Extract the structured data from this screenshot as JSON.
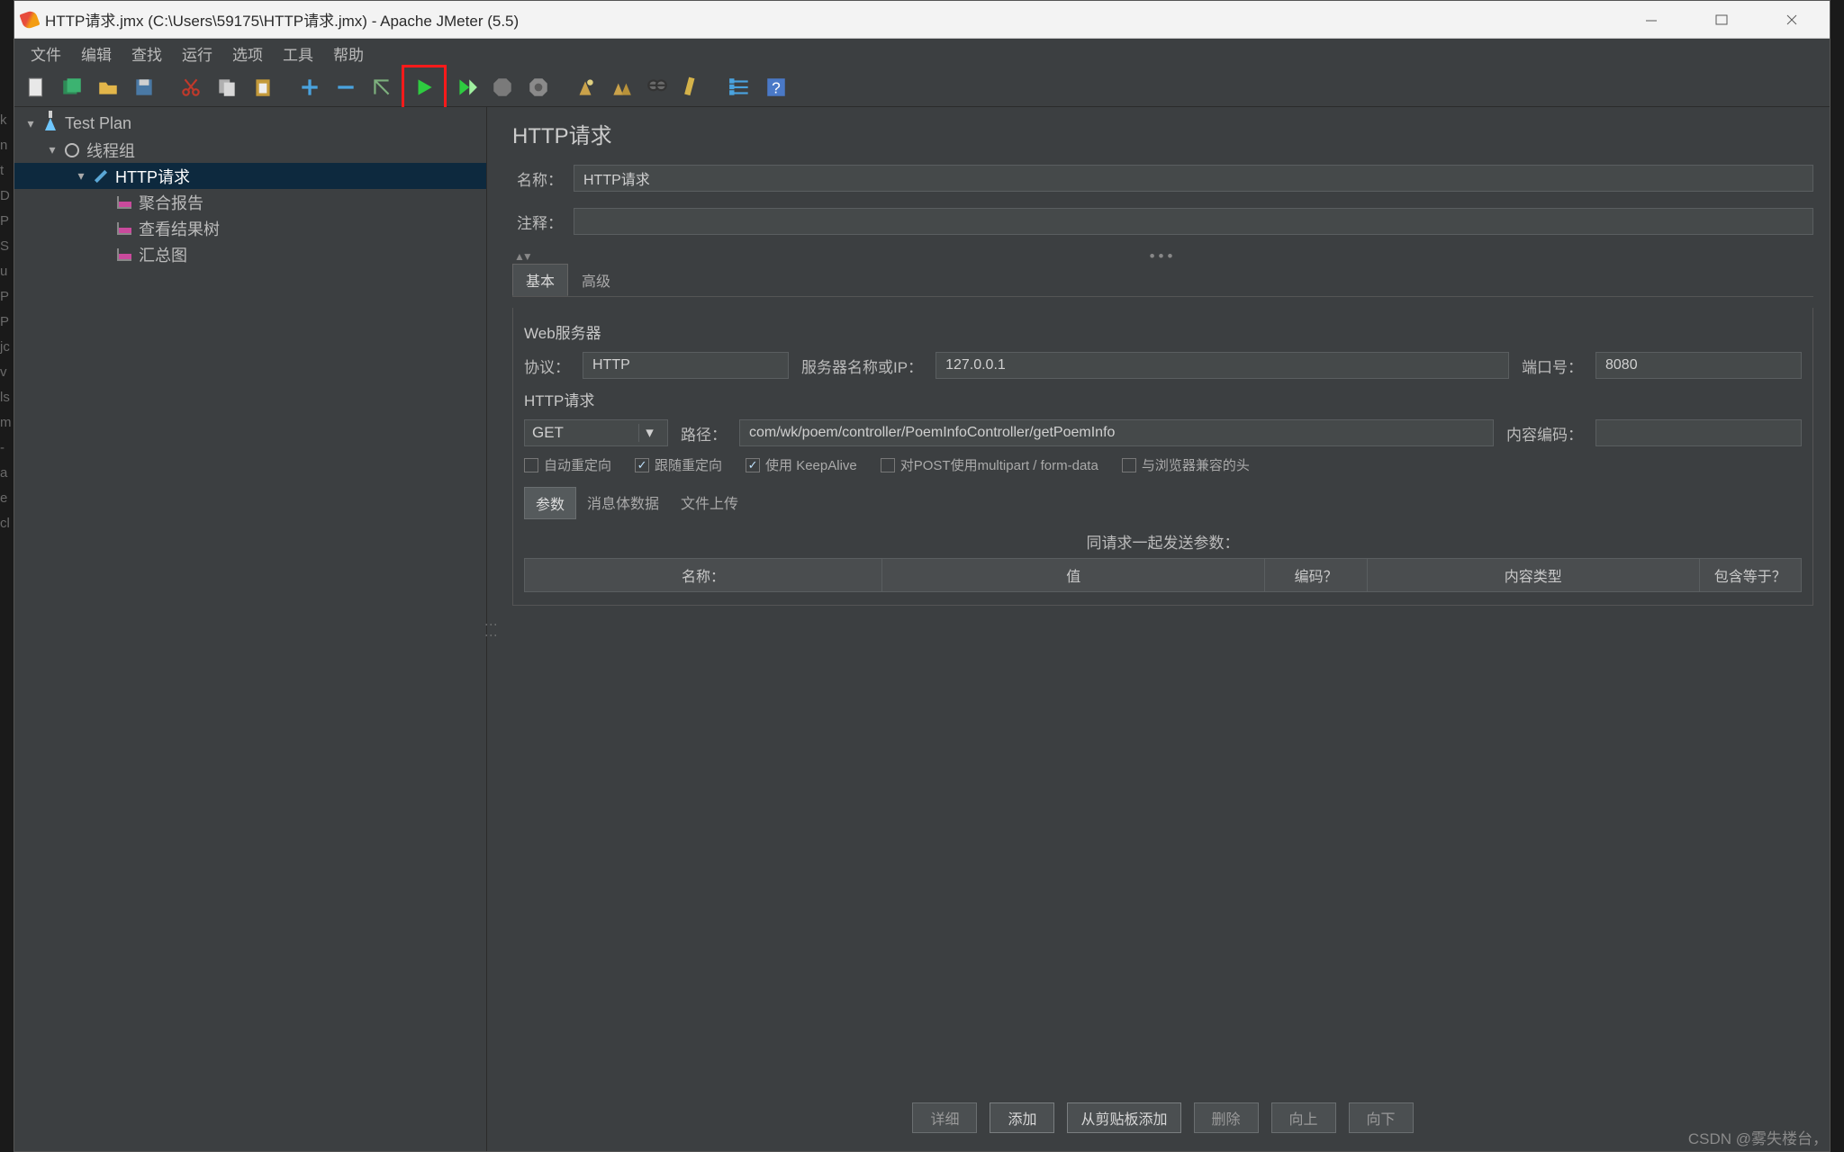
{
  "titlebar": {
    "title": "HTTP请求.jmx (C:\\Users\\59175\\HTTP请求.jmx) - Apache JMeter (5.5)"
  },
  "menus": [
    "文件",
    "编辑",
    "查找",
    "运行",
    "选项",
    "工具",
    "帮助"
  ],
  "toolbar_icons": [
    "new-file",
    "templates",
    "open",
    "save",
    "cut",
    "copy",
    "paste",
    "plus",
    "minus",
    "wand",
    "run",
    "run-next",
    "stop",
    "shutdown",
    "clear",
    "clear-all",
    "search",
    "fn-helper",
    "tree-toggle",
    "help"
  ],
  "tree": {
    "root": "Test Plan",
    "thread_group": "线程组",
    "http_request": "HTTP请求",
    "children": [
      "聚合报告",
      "查看结果树",
      "汇总图"
    ]
  },
  "editor": {
    "heading": "HTTP请求",
    "name_label": "名称：",
    "name_value": "HTTP请求",
    "comment_label": "注释：",
    "comment_value": "",
    "tabs": {
      "basic": "基本",
      "advanced": "高级"
    },
    "web_server": {
      "legend": "Web服务器",
      "protocol_label": "协议：",
      "protocol_value": "HTTP",
      "server_label": "服务器名称或IP：",
      "server_value": "127.0.0.1",
      "port_label": "端口号：",
      "port_value": "8080"
    },
    "http_req": {
      "legend": "HTTP请求",
      "method": "GET",
      "path_label": "路径：",
      "path_value": "com/wk/poem/controller/PoemInfoController/getPoemInfo",
      "enc_label": "内容编码：",
      "enc_value": ""
    },
    "checks": {
      "auto_redirect": "自动重定向",
      "follow_redirect": "跟随重定向",
      "keepalive": "使用 KeepAlive",
      "multipart": "对POST使用multipart / form-data",
      "browser_headers": "与浏览器兼容的头"
    },
    "inner_tabs": {
      "params": "参数",
      "body": "消息体数据",
      "files": "文件上传"
    },
    "param_caption": "同请求一起发送参数：",
    "param_cols": [
      "名称：",
      "值",
      "编码？",
      "内容类型",
      "包含等于？"
    ],
    "buttons": {
      "detail": "详细",
      "add": "添加",
      "clipboard": "从剪贴板添加",
      "delete": "删除",
      "up": "向上",
      "down": "向下"
    }
  },
  "watermark": "CSDN @雾失楼台，"
}
